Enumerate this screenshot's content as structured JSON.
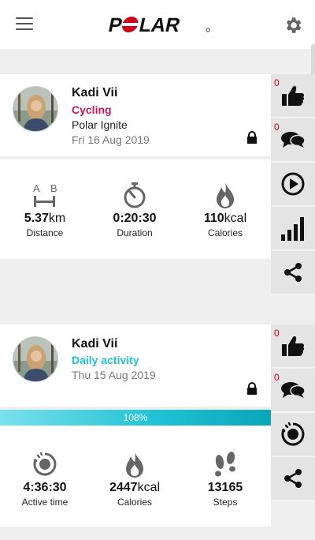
{
  "app": {
    "brand": "POLAR"
  },
  "feed": [
    {
      "user_name": "Kadi Vii",
      "activity": "Cycling",
      "activity_color": "#c2185b",
      "device": "Polar Ignite",
      "date": "Fri 16 Aug 2019",
      "stats": [
        {
          "icon": "ab-distance-icon",
          "value": "5.37",
          "unit": "km",
          "label": "Distance"
        },
        {
          "icon": "stopwatch-icon",
          "value": "0:20:30",
          "unit": "",
          "label": "Duration"
        },
        {
          "icon": "flame-icon",
          "value": "110",
          "unit": "kcal",
          "label": "Calories"
        }
      ],
      "likes": "0",
      "comments": "0"
    },
    {
      "user_name": "Kadi Vii",
      "activity": "Daily activity",
      "activity_color": "#1ec1d3",
      "date": "Thu 15 Aug 2019",
      "progress_text": "108%",
      "progress_fraction": 1.0,
      "stats": [
        {
          "icon": "active-time-icon",
          "value": "4:36:30",
          "unit": "",
          "label": "Active time"
        },
        {
          "icon": "flame-icon",
          "value": "2447",
          "unit": "kcal",
          "label": "Calories"
        },
        {
          "icon": "footsteps-icon",
          "value": "13165",
          "unit": "",
          "label": "Steps"
        }
      ],
      "likes": "0",
      "comments": "0"
    }
  ]
}
